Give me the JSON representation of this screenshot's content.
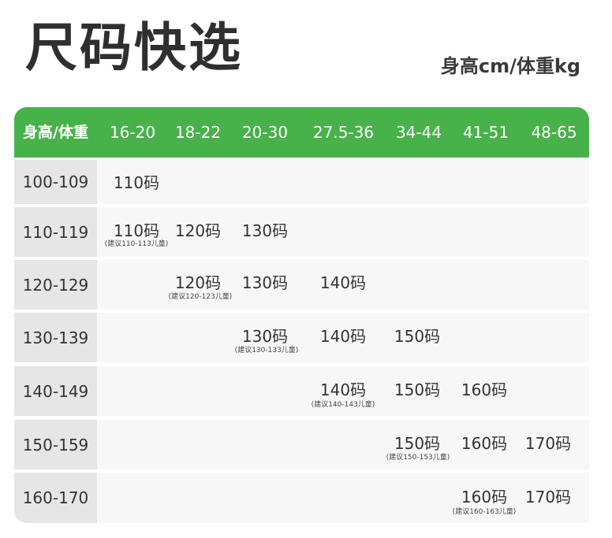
{
  "title": "尺码快选",
  "unit_label": "身高cm/体重kg",
  "header": [
    "身高/体重",
    "16-20",
    "18-22",
    "20-30",
    "27.5-36",
    "34-44",
    "41-51",
    "48-65"
  ],
  "rows": [
    {
      "label": "100-109",
      "sizes": [
        "110码"
      ],
      "note": ""
    },
    {
      "label": "110-119",
      "sizes": [
        "110码",
        "120码",
        "130码"
      ],
      "note": "(建议110-113儿童)"
    },
    {
      "label": "120-129",
      "sizes": [
        "120码",
        "130码",
        "140码"
      ],
      "note": "(建议120-123儿童)"
    },
    {
      "label": "130-139",
      "sizes": [
        "130码",
        "140码",
        "150码"
      ],
      "note": "(建议130-133儿童)"
    },
    {
      "label": "140-149",
      "sizes": [
        "140码",
        "150码",
        "160码"
      ],
      "note": "(建议140-143儿童)"
    },
    {
      "label": "150-159",
      "sizes": [
        "150码",
        "160码",
        "170码"
      ],
      "note": "(建议150-153儿童)"
    },
    {
      "label": "160-170",
      "sizes": [
        "160码",
        "170码"
      ],
      "note": "(建议160-163儿童)"
    }
  ],
  "colors": {
    "header_green": "#47b24a",
    "label_bg": "#e6e6e6",
    "row_bg": "#f7f7f7"
  }
}
